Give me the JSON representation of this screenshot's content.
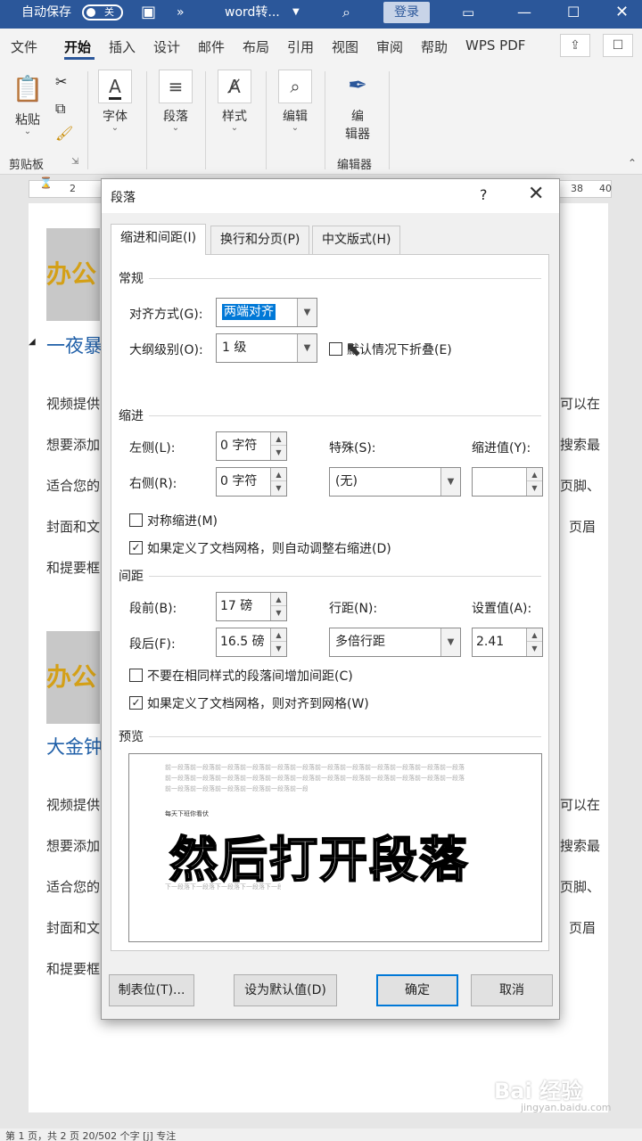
{
  "titlebar": {
    "autosave": "自动保存",
    "toggle": "关",
    "more": "»",
    "doc_title": "word转...",
    "login": "登录"
  },
  "menu": {
    "items": [
      "文件",
      "开始",
      "插入",
      "设计",
      "邮件",
      "布局",
      "引用",
      "视图",
      "审阅",
      "帮助",
      "WPS PDF"
    ],
    "active": "开始"
  },
  "ribbon": {
    "paste": "粘贴",
    "clipboard": "剪贴板",
    "font": "字体",
    "paragraph": "段落",
    "style": "样式",
    "edit": "编辑",
    "editor_1": "编",
    "editor_2": "辑器",
    "editor_group": "编辑器"
  },
  "ruler": {
    "left_num": "2",
    "n38": "38",
    "n40": "40"
  },
  "doc": {
    "heading_block": "办公",
    "h1": "一夜暴",
    "lines_left": [
      "视频提供",
      "想要添加",
      "适合您的",
      "封面和文",
      "和提要框"
    ],
    "lines_right": [
      "可以在",
      "搜索最",
      "页脚、",
      "页眉"
    ],
    "heading_block2": "办公",
    "h2": "大金钟",
    "lines_left2": [
      "视频提供",
      "想要添加",
      "适合您的",
      "封面和文",
      "和提要框"
    ],
    "lines_right2": [
      "可以在",
      "搜索最",
      "页脚、",
      "页眉"
    ]
  },
  "dialog": {
    "title": "段落",
    "help": "?",
    "close": "✕",
    "tabs": [
      "缩进和间距(I)",
      "换行和分页(P)",
      "中文版式(H)"
    ],
    "general": {
      "section": "常规",
      "align_label": "对齐方式(G):",
      "align_value": "两端对齐",
      "outline_label": "大纲级别(O):",
      "outline_value": "1 级",
      "collapse_label": "默认情况下折叠(E)"
    },
    "indent": {
      "section": "缩进",
      "left_label": "左侧(L):",
      "left_value": "0 字符",
      "right_label": "右侧(R):",
      "right_value": "0 字符",
      "special_label": "特殊(S):",
      "special_value": "(无)",
      "by_label": "缩进值(Y):",
      "by_value": "",
      "mirror_label": "对称缩进(M)",
      "grid_label": "如果定义了文档网格，则自动调整右缩进(D)"
    },
    "spacing": {
      "section": "间距",
      "before_label": "段前(B):",
      "before_value": "17 磅",
      "after_label": "段后(F):",
      "after_value": "16.5 磅",
      "line_label": "行距(N):",
      "line_value": "多倍行距",
      "at_label": "设置值(A):",
      "at_value": "2.41",
      "nospace_label": "不要在相同样式的段落间增加间距(C)",
      "snap_label": "如果定义了文档网格，则对齐到网格(W)"
    },
    "preview": {
      "section": "预览",
      "prev_line": "前一段落前一段落前一段落前一段落前一段落前一段落前一段落前一段落前一段落前一段落前一段落前一段落",
      "sample": "每天下班你看伏",
      "next_line": "下一段落下一段落下一段落下一段落下一段落下一段落下一段落下一段落下一段落下一段落"
    },
    "buttons": {
      "tabs": "制表位(T)...",
      "default": "设为默认值(D)",
      "ok": "确定",
      "cancel": "取消"
    }
  },
  "subtitle": "然后打开段落",
  "status": {
    "text": "第 1 页，共 2 页    20/502 个字        [j] 专注"
  },
  "watermark": {
    "brand": "Bai 经验",
    "url": "jingyan.baidu.com"
  }
}
